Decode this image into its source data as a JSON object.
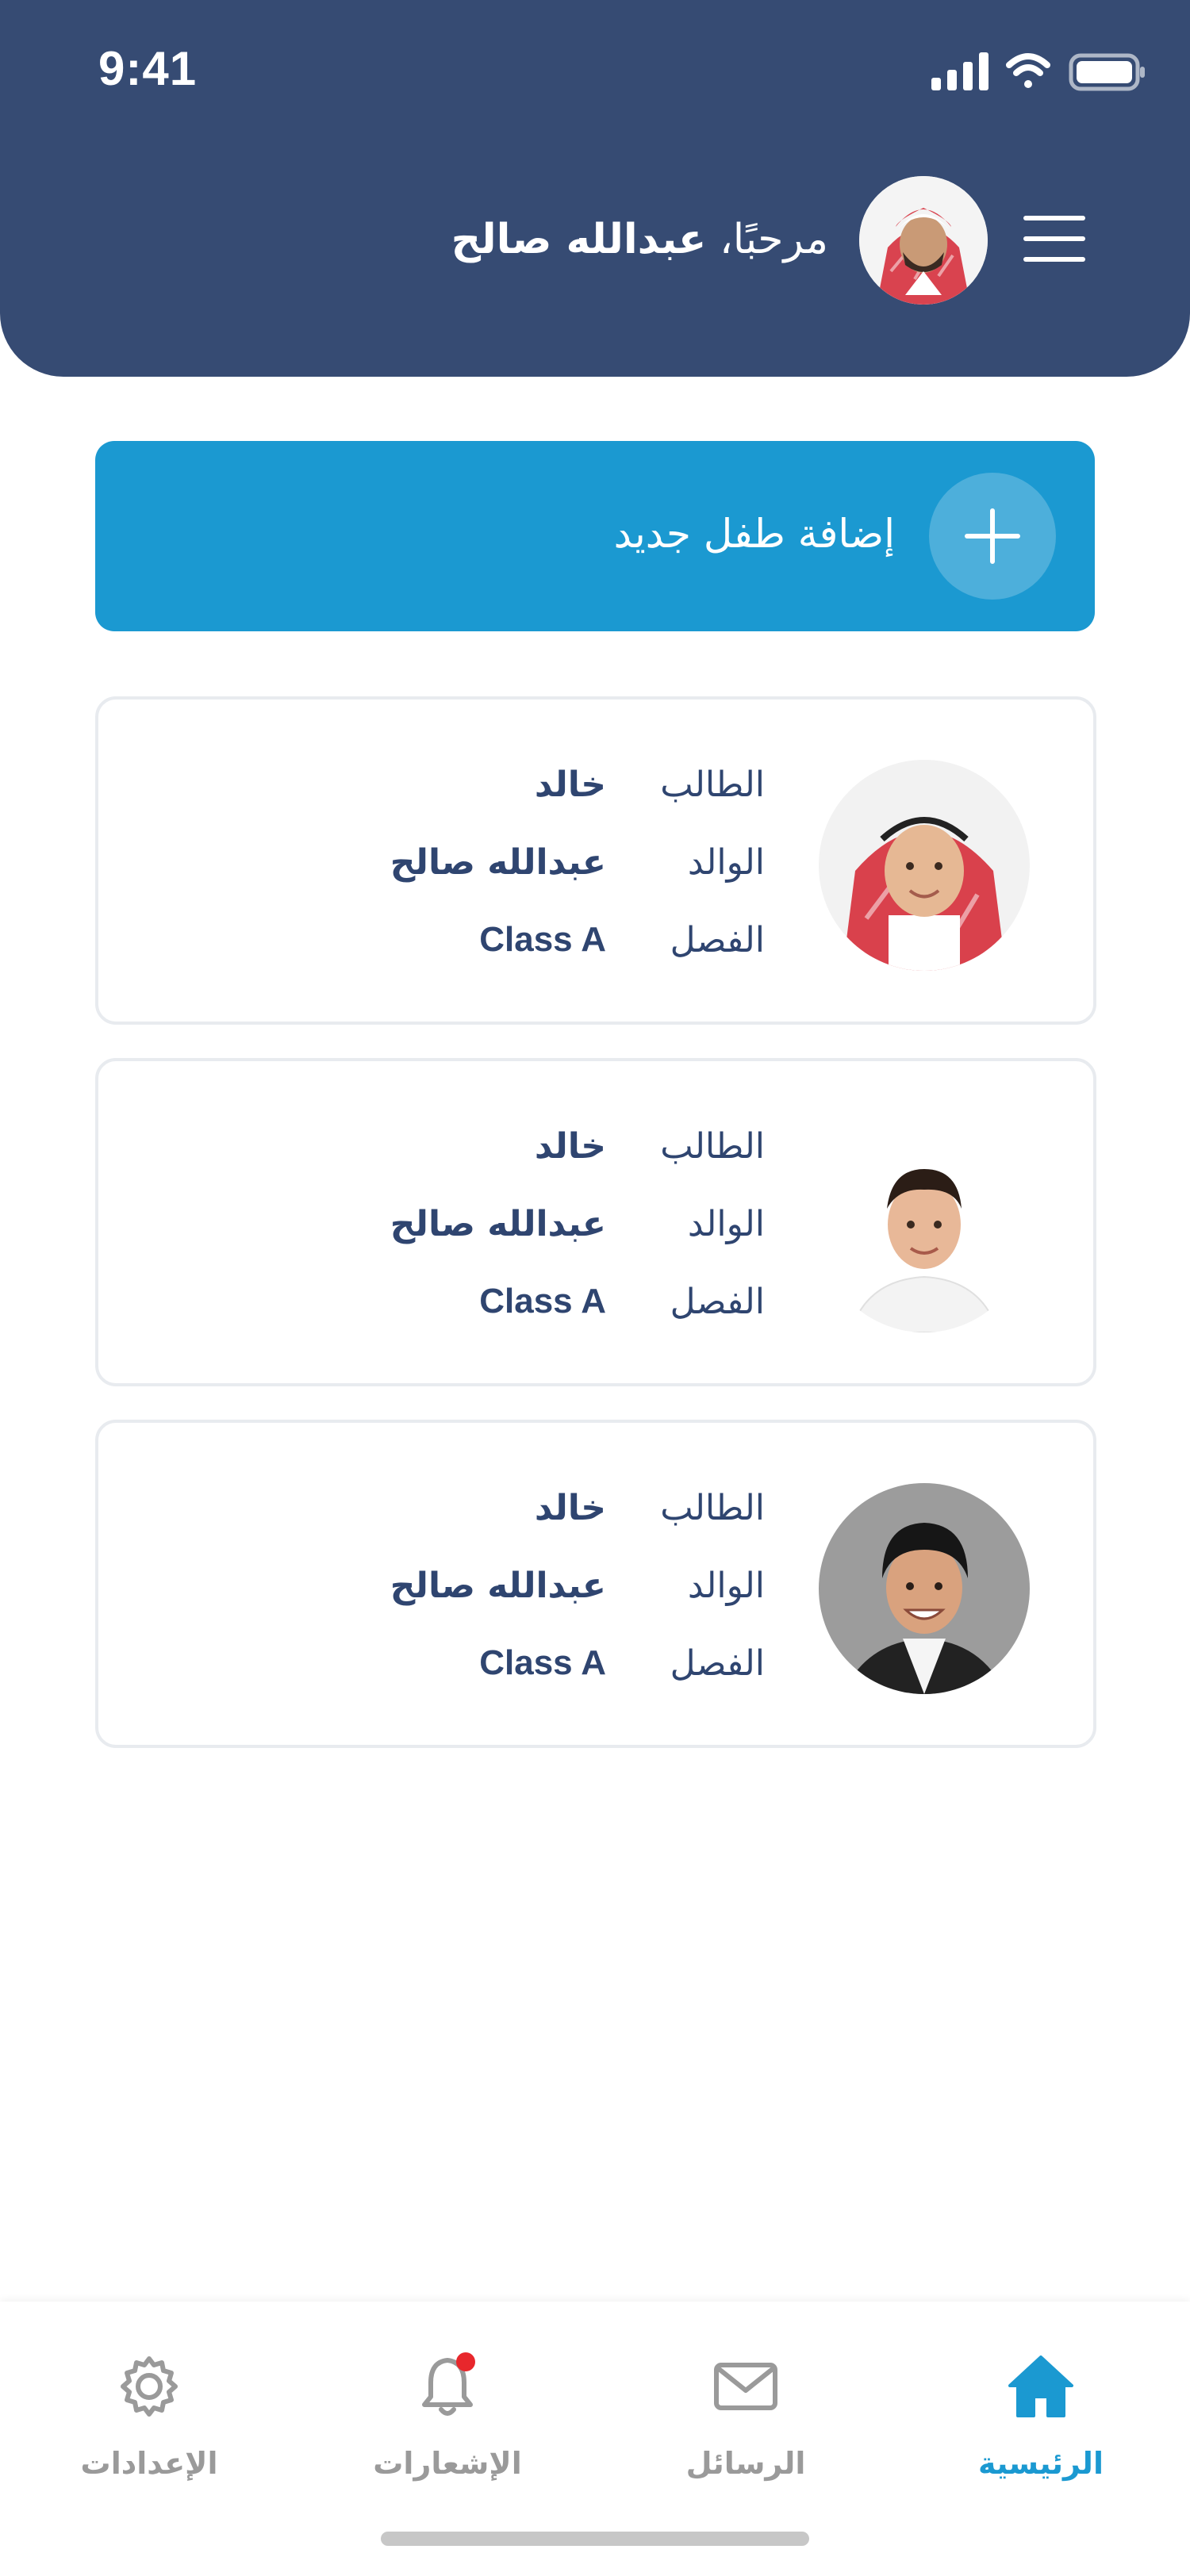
{
  "status_bar": {
    "time": "9:41"
  },
  "header": {
    "greeting_prefix": "مرحبًا،",
    "user_name": "عبدالله صالح"
  },
  "add_child": {
    "label": "إضافة طفل جديد"
  },
  "children": [
    {
      "student_label": "الطالب",
      "student_value": "خالد",
      "parent_label": "الوالد",
      "parent_value": "عبدالله صالح",
      "class_label": "الفصل",
      "class_value": "Class A"
    },
    {
      "student_label": "الطالب",
      "student_value": "خالد",
      "parent_label": "الوالد",
      "parent_value": "عبدالله صالح",
      "class_label": "الفصل",
      "class_value": "Class A"
    },
    {
      "student_label": "الطالب",
      "student_value": "خالد",
      "parent_label": "الوالد",
      "parent_value": "عبدالله صالح",
      "class_label": "الفصل",
      "class_value": "Class A"
    }
  ],
  "bottom_nav": [
    {
      "label": "الإعدادات",
      "icon": "gear-icon",
      "active": false
    },
    {
      "label": "الإشعارات",
      "icon": "bell-icon",
      "active": false,
      "badge": true
    },
    {
      "label": "الرسائل",
      "icon": "envelope-icon",
      "active": false
    },
    {
      "label": "الرئيسية",
      "icon": "home-icon",
      "active": true
    }
  ],
  "colors": {
    "header_bg": "#364b73",
    "accent_blue": "#1b99d1",
    "text_dark": "#2f4570",
    "inactive_gray": "#9a9a9a",
    "badge_red": "#e8272c"
  }
}
